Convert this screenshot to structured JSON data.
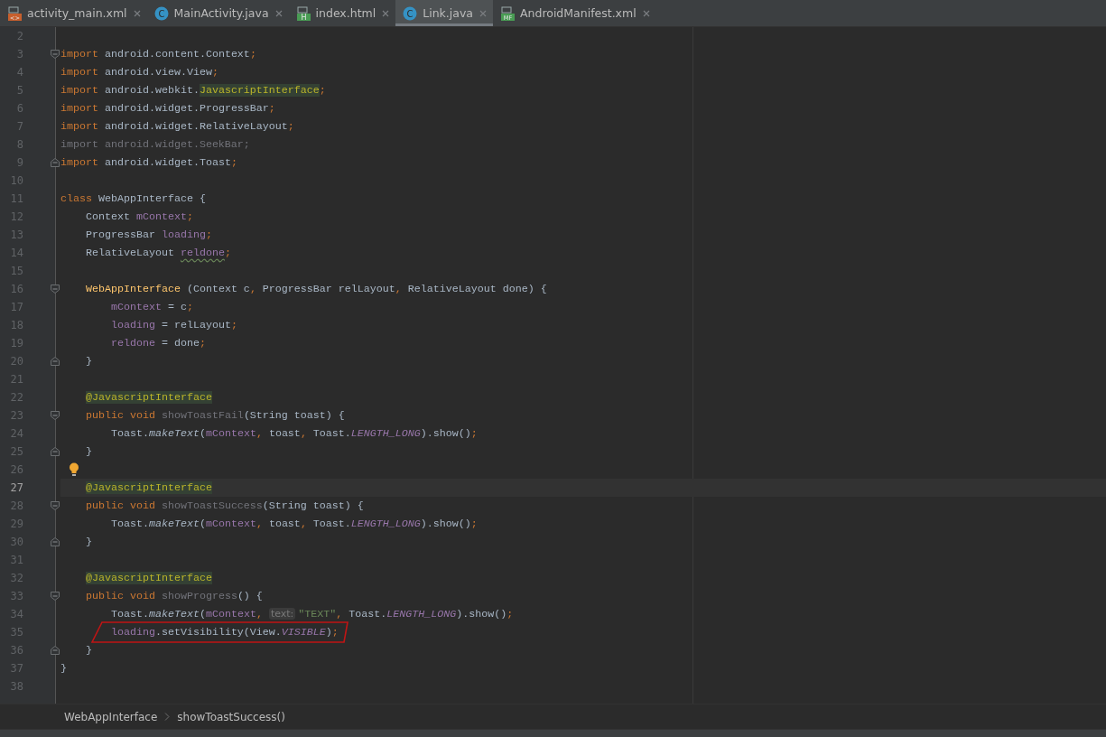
{
  "tabs": [
    {
      "label": "activity_main.xml",
      "kind": "xml",
      "icon_label": "<>",
      "selected": false
    },
    {
      "label": "MainActivity.java",
      "kind": "class",
      "icon_label": "C",
      "selected": false
    },
    {
      "label": "index.html",
      "kind": "html",
      "icon_label": "H",
      "selected": false
    },
    {
      "label": "Link.java",
      "kind": "class",
      "icon_label": "C",
      "selected": true
    },
    {
      "label": "AndroidManifest.xml",
      "kind": "manifest",
      "icon_label": "MF",
      "selected": false
    }
  ],
  "editor": {
    "lines": [
      {
        "n": "2",
        "fold_start": false,
        "fold_end": false,
        "current": false,
        "bulb": false,
        "circled": false
      },
      {
        "n": "3",
        "fold_start": true,
        "fold_end": false,
        "current": false,
        "bulb": false,
        "circled": false,
        "tokens": [
          {
            "text": "import",
            "kind": "kw"
          },
          {
            "text": " android.content.Context",
            "kind": "plain"
          },
          {
            "text": ";",
            "kind": "punct"
          }
        ]
      },
      {
        "n": "4",
        "fold_start": false,
        "fold_end": false,
        "current": false,
        "bulb": false,
        "circled": false,
        "tokens": [
          {
            "text": "import",
            "kind": "kw"
          },
          {
            "text": " android.view.View",
            "kind": "plain"
          },
          {
            "text": ";",
            "kind": "punct"
          }
        ]
      },
      {
        "n": "5",
        "fold_start": false,
        "fold_end": false,
        "current": false,
        "bulb": false,
        "circled": false,
        "tokens": [
          {
            "text": "import",
            "kind": "kw"
          },
          {
            "text": " android.webkit.",
            "kind": "plain"
          },
          {
            "text": "JavascriptInterface",
            "kind": "annhl"
          },
          {
            "text": ";",
            "kind": "punct"
          }
        ]
      },
      {
        "n": "6",
        "fold_start": false,
        "fold_end": false,
        "current": false,
        "bulb": false,
        "circled": false,
        "tokens": [
          {
            "text": "import",
            "kind": "kw"
          },
          {
            "text": " android.widget.ProgressBar",
            "kind": "plain"
          },
          {
            "text": ";",
            "kind": "punct"
          }
        ]
      },
      {
        "n": "7",
        "fold_start": false,
        "fold_end": false,
        "current": false,
        "bulb": false,
        "circled": false,
        "tokens": [
          {
            "text": "import",
            "kind": "kw"
          },
          {
            "text": " android.widget.RelativeLayout",
            "kind": "plain"
          },
          {
            "text": ";",
            "kind": "punct"
          }
        ]
      },
      {
        "n": "8",
        "fold_start": false,
        "fold_end": false,
        "current": false,
        "bulb": false,
        "circled": false,
        "tokens": [
          {
            "text": "import android.widget.SeekBar;",
            "kind": "unused"
          }
        ]
      },
      {
        "n": "9",
        "fold_start": false,
        "fold_end": true,
        "current": false,
        "bulb": false,
        "circled": false,
        "tokens": [
          {
            "text": "import",
            "kind": "kw"
          },
          {
            "text": " android.widget.Toast",
            "kind": "plain"
          },
          {
            "text": ";",
            "kind": "punct"
          }
        ]
      },
      {
        "n": "10",
        "fold_start": false,
        "fold_end": false,
        "current": false,
        "bulb": false,
        "circled": false
      },
      {
        "n": "11",
        "fold_start": false,
        "fold_end": false,
        "current": false,
        "bulb": false,
        "circled": false,
        "tokens": [
          {
            "text": "class",
            "kind": "kw"
          },
          {
            "text": " WebAppInterface {",
            "kind": "plain"
          }
        ]
      },
      {
        "n": "12",
        "fold_start": false,
        "fold_end": false,
        "current": false,
        "bulb": false,
        "circled": false,
        "tokens": [
          {
            "text": "    Context ",
            "kind": "plain"
          },
          {
            "text": "mContext",
            "kind": "field"
          },
          {
            "text": ";",
            "kind": "punct"
          }
        ]
      },
      {
        "n": "13",
        "fold_start": false,
        "fold_end": false,
        "current": false,
        "bulb": false,
        "circled": false,
        "tokens": [
          {
            "text": "    ProgressBar ",
            "kind": "plain"
          },
          {
            "text": "loading",
            "kind": "field"
          },
          {
            "text": ";",
            "kind": "punct"
          }
        ]
      },
      {
        "n": "14",
        "fold_start": false,
        "fold_end": false,
        "current": false,
        "bulb": false,
        "circled": false,
        "tokens": [
          {
            "text": "    RelativeLayout ",
            "kind": "plain"
          },
          {
            "text": "reldone",
            "kind": "warn"
          },
          {
            "text": ";",
            "kind": "punct"
          }
        ]
      },
      {
        "n": "15",
        "fold_start": false,
        "fold_end": false,
        "current": false,
        "bulb": false,
        "circled": false
      },
      {
        "n": "16",
        "fold_start": true,
        "fold_end": false,
        "current": false,
        "bulb": false,
        "circled": false,
        "tokens": [
          {
            "text": "    WebAppInterface",
            "kind": "decl"
          },
          {
            "text": " (Context c",
            "kind": "plain"
          },
          {
            "text": ",",
            "kind": "punct"
          },
          {
            "text": " ProgressBar relLayout",
            "kind": "plain"
          },
          {
            "text": ",",
            "kind": "punct"
          },
          {
            "text": " RelativeLayout done) {",
            "kind": "plain"
          }
        ]
      },
      {
        "n": "17",
        "fold_start": false,
        "fold_end": false,
        "current": false,
        "bulb": false,
        "circled": false,
        "tokens": [
          {
            "text": "        mContext",
            "kind": "field"
          },
          {
            "text": " = c",
            "kind": "plain"
          },
          {
            "text": ";",
            "kind": "punct"
          }
        ]
      },
      {
        "n": "18",
        "fold_start": false,
        "fold_end": false,
        "current": false,
        "bulb": false,
        "circled": false,
        "tokens": [
          {
            "text": "        loading",
            "kind": "field"
          },
          {
            "text": " = relLayout",
            "kind": "plain"
          },
          {
            "text": ";",
            "kind": "punct"
          }
        ]
      },
      {
        "n": "19",
        "fold_start": false,
        "fold_end": false,
        "current": false,
        "bulb": false,
        "circled": false,
        "tokens": [
          {
            "text": "        reldone",
            "kind": "field"
          },
          {
            "text": " = done",
            "kind": "plain"
          },
          {
            "text": ";",
            "kind": "punct"
          }
        ]
      },
      {
        "n": "20",
        "fold_start": false,
        "fold_end": true,
        "current": false,
        "bulb": false,
        "circled": false,
        "tokens": [
          {
            "text": "    }",
            "kind": "plain"
          }
        ]
      },
      {
        "n": "21",
        "fold_start": false,
        "fold_end": false,
        "current": false,
        "bulb": false,
        "circled": false
      },
      {
        "n": "22",
        "fold_start": false,
        "fold_end": false,
        "current": false,
        "bulb": false,
        "circled": false,
        "tokens": [
          {
            "text": "    @JavascriptInterface",
            "kind": "annhl"
          }
        ]
      },
      {
        "n": "23",
        "fold_start": true,
        "fold_end": false,
        "current": false,
        "bulb": false,
        "circled": false,
        "tokens": [
          {
            "text": "    public void",
            "kind": "kw"
          },
          {
            "text": " showToastFail",
            "kind": "unused"
          },
          {
            "text": "(String toast) {",
            "kind": "plain"
          }
        ]
      },
      {
        "n": "24",
        "fold_start": false,
        "fold_end": false,
        "current": false,
        "bulb": false,
        "circled": false,
        "tokens": [
          {
            "text": "        Toast.",
            "kind": "plain"
          },
          {
            "text": "makeText",
            "kind": "call"
          },
          {
            "text": "(",
            "kind": "plain"
          },
          {
            "text": "mContext",
            "kind": "field"
          },
          {
            "text": ",",
            "kind": "punct"
          },
          {
            "text": " toast",
            "kind": "plain"
          },
          {
            "text": ",",
            "kind": "punct"
          },
          {
            "text": " Toast.",
            "kind": "plain"
          },
          {
            "text": "LENGTH_LONG",
            "kind": "static"
          },
          {
            "text": ").show()",
            "kind": "plain"
          },
          {
            "text": ";",
            "kind": "punct"
          }
        ]
      },
      {
        "n": "25",
        "fold_start": false,
        "fold_end": true,
        "current": false,
        "bulb": false,
        "circled": false,
        "tokens": [
          {
            "text": "    }",
            "kind": "plain"
          }
        ]
      },
      {
        "n": "26",
        "fold_start": false,
        "fold_end": false,
        "current": false,
        "bulb": true,
        "circled": false
      },
      {
        "n": "27",
        "fold_start": false,
        "fold_end": false,
        "current": true,
        "bulb": false,
        "circled": false,
        "tokens": [
          {
            "text": "    @JavascriptInterface",
            "kind": "annhl"
          }
        ]
      },
      {
        "n": "28",
        "fold_start": true,
        "fold_end": false,
        "current": false,
        "bulb": false,
        "circled": false,
        "tokens": [
          {
            "text": "    public void",
            "kind": "kw"
          },
          {
            "text": " showToastSuccess",
            "kind": "unused"
          },
          {
            "text": "(String toast) {",
            "kind": "plain"
          }
        ]
      },
      {
        "n": "29",
        "fold_start": false,
        "fold_end": false,
        "current": false,
        "bulb": false,
        "circled": false,
        "tokens": [
          {
            "text": "        Toast.",
            "kind": "plain"
          },
          {
            "text": "makeText",
            "kind": "call"
          },
          {
            "text": "(",
            "kind": "plain"
          },
          {
            "text": "mContext",
            "kind": "field"
          },
          {
            "text": ",",
            "kind": "punct"
          },
          {
            "text": " toast",
            "kind": "plain"
          },
          {
            "text": ",",
            "kind": "punct"
          },
          {
            "text": " Toast.",
            "kind": "plain"
          },
          {
            "text": "LENGTH_LONG",
            "kind": "static"
          },
          {
            "text": ").show()",
            "kind": "plain"
          },
          {
            "text": ";",
            "kind": "punct"
          }
        ]
      },
      {
        "n": "30",
        "fold_start": false,
        "fold_end": true,
        "current": false,
        "bulb": false,
        "circled": false,
        "tokens": [
          {
            "text": "    }",
            "kind": "plain"
          }
        ]
      },
      {
        "n": "31",
        "fold_start": false,
        "fold_end": false,
        "current": false,
        "bulb": false,
        "circled": false
      },
      {
        "n": "32",
        "fold_start": false,
        "fold_end": false,
        "current": false,
        "bulb": false,
        "circled": false,
        "tokens": [
          {
            "text": "    @JavascriptInterface",
            "kind": "annhl"
          }
        ]
      },
      {
        "n": "33",
        "fold_start": true,
        "fold_end": false,
        "current": false,
        "bulb": false,
        "circled": false,
        "tokens": [
          {
            "text": "    public void",
            "kind": "kw"
          },
          {
            "text": " showProgress",
            "kind": "unused"
          },
          {
            "text": "() {",
            "kind": "plain"
          }
        ]
      },
      {
        "n": "34",
        "fold_start": false,
        "fold_end": false,
        "current": false,
        "bulb": false,
        "circled": false,
        "tokens": [
          {
            "text": "        Toast.",
            "kind": "plain"
          },
          {
            "text": "makeText",
            "kind": "call"
          },
          {
            "text": "(",
            "kind": "plain"
          },
          {
            "text": "mContext",
            "kind": "field"
          },
          {
            "text": ",",
            "kind": "punct"
          },
          {
            "text": "text:",
            "kind": "hint"
          },
          {
            "text": "\"TEXT\"",
            "kind": "str"
          },
          {
            "text": ",",
            "kind": "punct"
          },
          {
            "text": " Toast.",
            "kind": "plain"
          },
          {
            "text": "LENGTH_LONG",
            "kind": "static"
          },
          {
            "text": ").show()",
            "kind": "plain"
          },
          {
            "text": ";",
            "kind": "punct"
          }
        ]
      },
      {
        "n": "35",
        "fold_start": false,
        "fold_end": false,
        "current": false,
        "bulb": false,
        "circled": true,
        "tokens": [
          {
            "text": "        loading",
            "kind": "field"
          },
          {
            "text": ".setVisibility(View.",
            "kind": "plain"
          },
          {
            "text": "VISIBLE",
            "kind": "static"
          },
          {
            "text": ")",
            "kind": "plain"
          },
          {
            "text": ";",
            "kind": "punct"
          }
        ]
      },
      {
        "n": "36",
        "fold_start": false,
        "fold_end": true,
        "current": false,
        "bulb": false,
        "circled": false,
        "tokens": [
          {
            "text": "    }",
            "kind": "plain"
          }
        ]
      },
      {
        "n": "37",
        "fold_start": false,
        "fold_end": false,
        "current": false,
        "bulb": false,
        "circled": false,
        "tokens": [
          {
            "text": "}",
            "kind": "plain"
          }
        ]
      },
      {
        "n": "38",
        "fold_start": false,
        "fold_end": false,
        "current": false,
        "bulb": false,
        "circled": false
      }
    ]
  },
  "breadcrumb": [
    "WebAppInterface",
    "showToastSuccess()"
  ]
}
